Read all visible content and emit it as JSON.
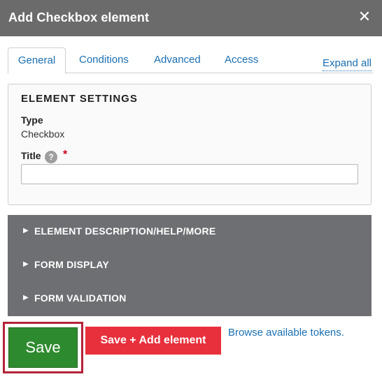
{
  "dialog": {
    "title": "Add Checkbox element",
    "close_symbol": "✕"
  },
  "tabs": [
    {
      "label": "General",
      "active": true
    },
    {
      "label": "Conditions",
      "active": false
    },
    {
      "label": "Advanced",
      "active": false
    },
    {
      "label": "Access",
      "active": false
    }
  ],
  "expand_all": "Expand all",
  "settings": {
    "heading": "ELEMENT SETTINGS",
    "type_label": "Type",
    "type_value": "Checkbox",
    "title_label": "Title",
    "help_symbol": "?",
    "required_marker": "*",
    "title_value": ""
  },
  "accordion": [
    {
      "arrow": "▶",
      "label": "ELEMENT DESCRIPTION/HELP/MORE"
    },
    {
      "arrow": "▶",
      "label": "FORM DISPLAY"
    },
    {
      "arrow": "▶",
      "label": "FORM VALIDATION"
    }
  ],
  "actions": {
    "save_label": "Save",
    "save_add_label": "Save + Add element",
    "tokens_link": "Browse available tokens."
  },
  "colors": {
    "titlebar": "#6b6b6b",
    "accordion": "#6e6f72",
    "save": "#2e8a2e",
    "save_add": "#e8303c",
    "highlight": "#b3233a",
    "link": "#1a6fb4"
  }
}
